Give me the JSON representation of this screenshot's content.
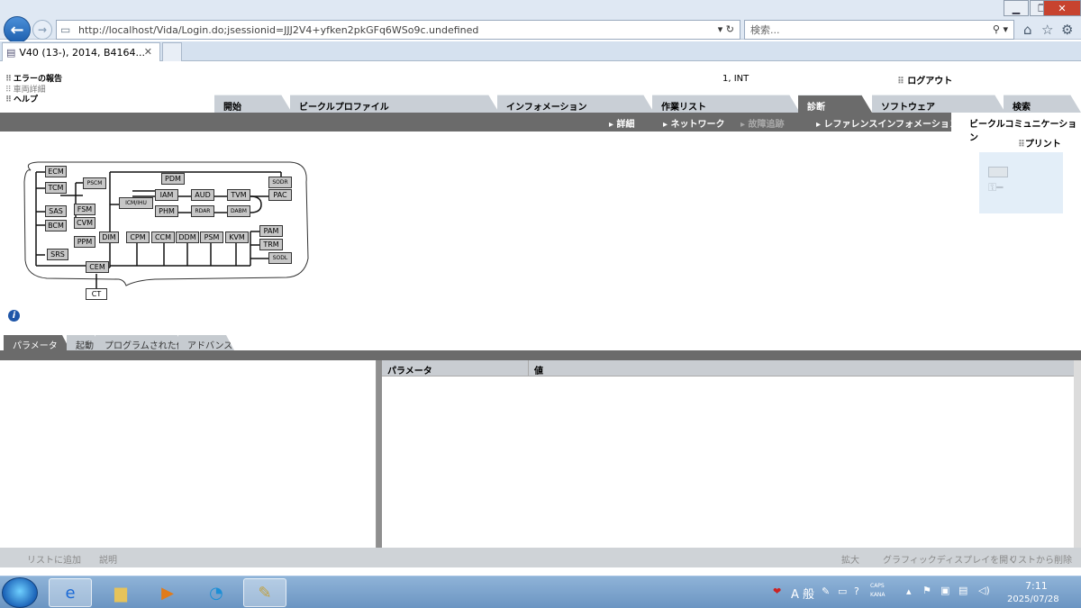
{
  "browser": {
    "address": "http://localhost/Vida/Login.do;jsessionid=JJJ2V4+yfken2pkGFq6WSo9c.undefined",
    "address_controls": "▾ ↻",
    "search_placeholder": "検索...",
    "search_controls": "⚲ ▾",
    "tab_title": "V40 (13-), 2014, B4164...",
    "tab_close": "✕"
  },
  "left_links": [
    "エラーの報告",
    "車両詳細",
    "ヘルプ"
  ],
  "user_info": "1, INT",
  "logout": "ログアウト",
  "main_tabs": [
    "開始",
    "ビークルプロファイル",
    "インフォメーション",
    "作業リスト",
    "診断",
    "ソフトウェア",
    "検索"
  ],
  "sub_nav": {
    "items": [
      "詳細",
      "ネットワーク",
      "故障追跡",
      "レファレンスインフォメーション"
    ],
    "active": "ビークルコミュニケーション"
  },
  "print_label": "プリント",
  "modules": [
    "ECM",
    "TCM",
    "PSCM",
    "SAS",
    "FSM",
    "BCM",
    "CVM",
    "PPM",
    "DIM",
    "SRS",
    "CEM",
    "CT",
    "PDM",
    "ICM/IHU",
    "IAM",
    "AUD",
    "TVM",
    "PHM",
    "RDAR",
    "DABM",
    "CPM",
    "CCM",
    "DDM",
    "PSM",
    "KVM",
    "SODR",
    "PAC",
    "PAM",
    "TRM",
    "SODL"
  ],
  "bottom_tabs": [
    "パラメータ",
    "起動",
    "プログラムされた値",
    "アドバンス"
  ],
  "table_columns": [
    "パラメータ",
    "値"
  ],
  "bottom_actions": {
    "add_to_list": "リストに追加",
    "description": "説明",
    "zoom": "拡大",
    "open_graphic": "グラフィックディスプレイを開く",
    "remove_from_list": "リストから削除"
  },
  "taskbar": {
    "ime_mode": "A 般",
    "caps_kana": "CAPS KANA",
    "time": "7:11",
    "date": "2025/07/28"
  }
}
